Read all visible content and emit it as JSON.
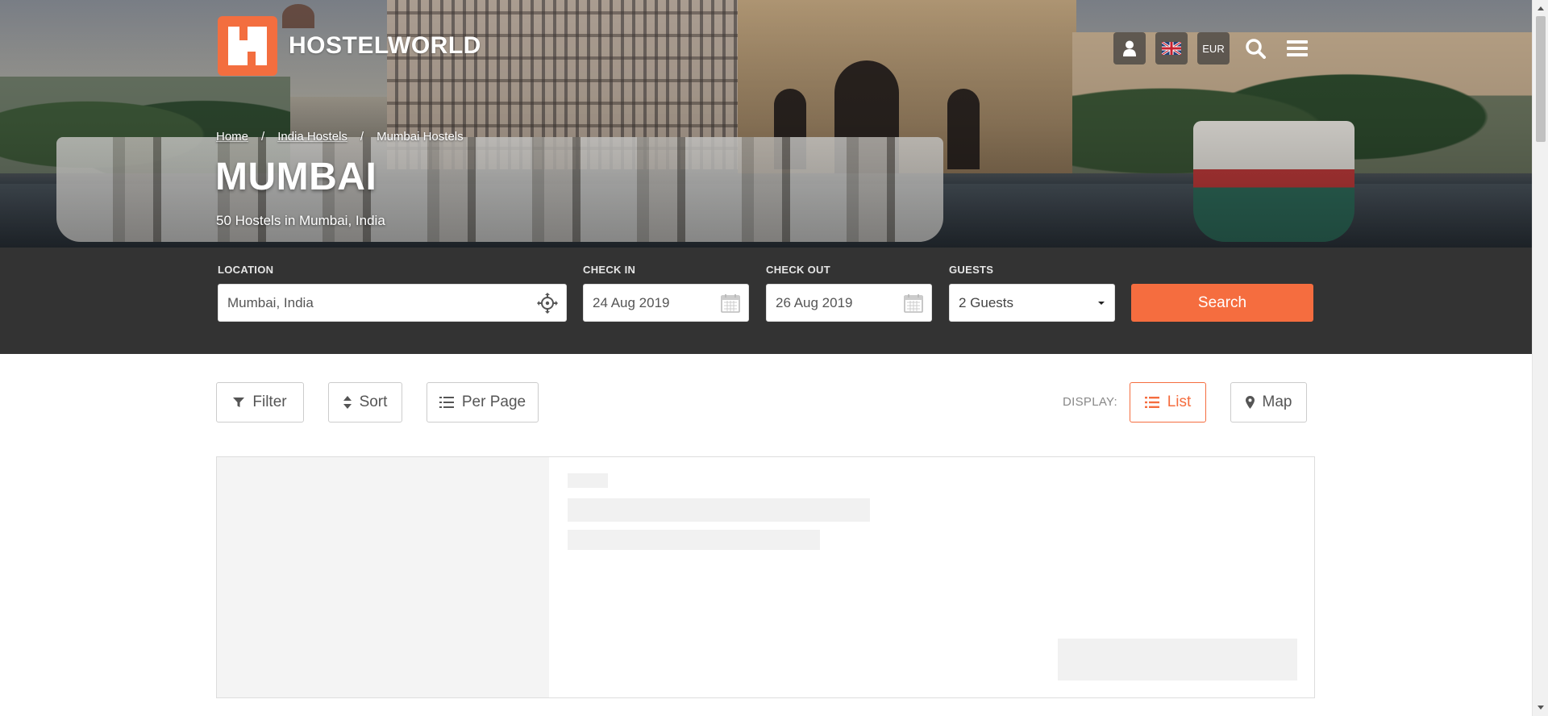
{
  "header": {
    "brand": "HOSTELWORLD",
    "currency": "EUR",
    "icons": [
      "user-icon",
      "uk-flag-icon",
      "search-icon",
      "hamburger-menu-icon"
    ]
  },
  "breadcrumb": {
    "items": [
      {
        "label": "Home"
      },
      {
        "label": "India Hostels"
      },
      {
        "label": "Mumbai Hostels"
      }
    ],
    "separator": "/"
  },
  "hero": {
    "title": "MUMBAI",
    "subtitle": "50 Hostels in Mumbai, India"
  },
  "search": {
    "location_label": "LOCATION",
    "location_value": "Mumbai, India",
    "checkin_label": "CHECK IN",
    "checkin_value": "24 Aug 2019",
    "checkout_label": "CHECK OUT",
    "checkout_value": "26 Aug 2019",
    "guests_label": "GUESTS",
    "guests_value": "2 Guests",
    "submit_label": "Search"
  },
  "toolbar": {
    "filter_label": "Filter",
    "sort_label": "Sort",
    "perpage_label": "Per Page",
    "display_label": "DISPLAY:",
    "list_label": "List",
    "map_label": "Map",
    "active_view": "List"
  },
  "colors": {
    "accent": "#f56d3f",
    "search_bar_bg": "#333333",
    "skeleton": "#f1f1f1"
  }
}
